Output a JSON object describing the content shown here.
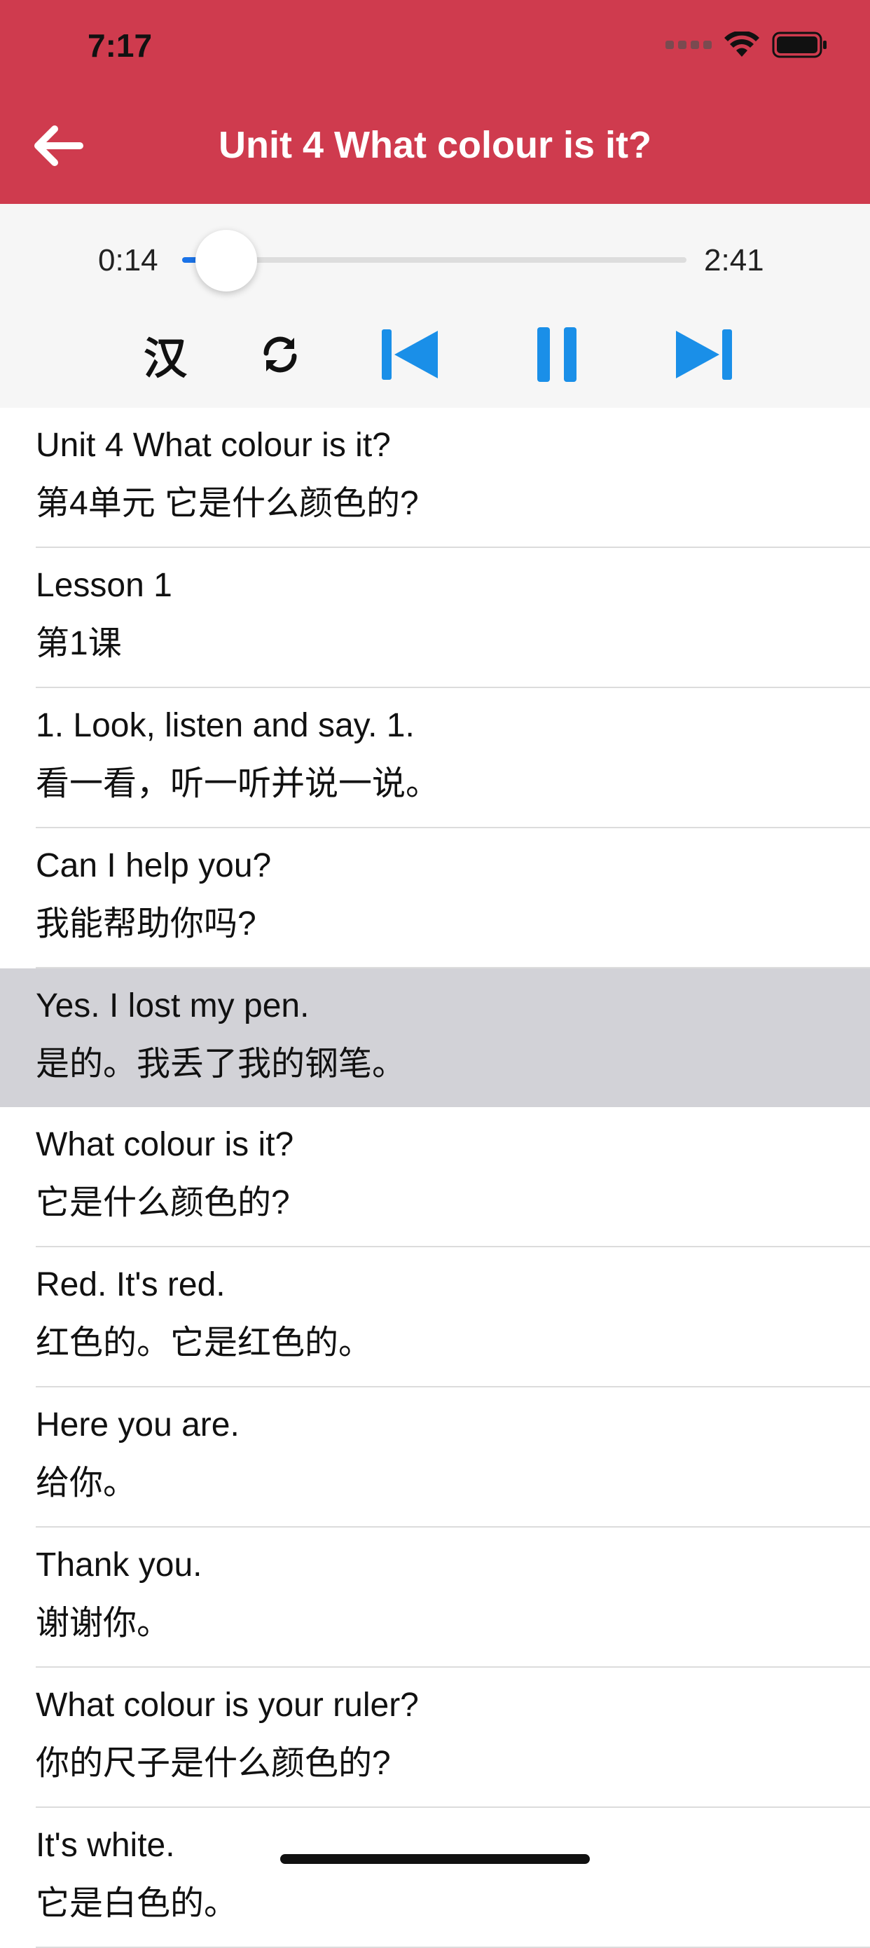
{
  "status_bar": {
    "time": "7:17"
  },
  "header": {
    "title": "Unit 4 What colour is it?",
    "color": "#cf3b4e"
  },
  "player": {
    "elapsed": "0:14",
    "total": "2:41",
    "progress": 0.087,
    "hanzi_toggle": "汉",
    "accent": "#1a73e8",
    "icons": [
      "repeat-icon",
      "skip-previous-icon",
      "pause-icon",
      "skip-next-icon"
    ]
  },
  "sentences": [
    {
      "en": "Unit 4 What colour is it?",
      "zh": "第4单元 它是什么颜色的?"
    },
    {
      "en": "Lesson 1",
      "zh": "第1课"
    },
    {
      "en": "1. Look, listen and say. 1.",
      "zh": "看一看，听一听并说一说。"
    },
    {
      "en": "Can I help you?",
      "zh": "我能帮助你吗?"
    },
    {
      "en": "Yes. I lost my pen.",
      "zh": "是的。我丢了我的钢笔。",
      "highlighted": true
    },
    {
      "en": "What colour is it?",
      "zh": "它是什么颜色的?"
    },
    {
      "en": "Red. It's red.",
      "zh": "红色的。它是红色的。"
    },
    {
      "en": "Here you are.",
      "zh": "给你。"
    },
    {
      "en": "Thank you.",
      "zh": "谢谢你。"
    },
    {
      "en": "What colour is your ruler?",
      "zh": "你的尺子是什么颜色的?"
    },
    {
      "en": "It's white.",
      "zh": "它是白色的。"
    }
  ]
}
